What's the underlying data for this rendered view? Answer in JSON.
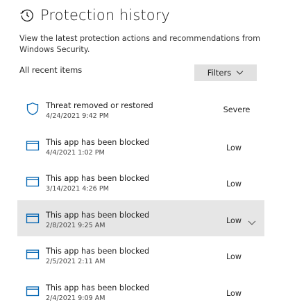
{
  "header": {
    "title": "Protection history",
    "icon": "history-icon"
  },
  "subtitle": "View the latest protection actions and recommendations from Windows Security.",
  "section_label": "All recent items",
  "filters_button": {
    "label": "Filters",
    "icon": "chevron-down-icon"
  },
  "items": [
    {
      "title": "Threat removed or restored",
      "date": "4/24/2021 9:42 PM",
      "severity": "Severe",
      "icon": "shield-icon",
      "selected": false
    },
    {
      "title": "This app has been blocked",
      "date": "4/4/2021 1:02 PM",
      "severity": "Low",
      "icon": "app-window-icon",
      "selected": false
    },
    {
      "title": "This app has been blocked",
      "date": "3/14/2021 4:26 PM",
      "severity": "Low",
      "icon": "app-window-icon",
      "selected": false
    },
    {
      "title": "This app has been blocked",
      "date": "2/8/2021 9:25 AM",
      "severity": "Low",
      "icon": "app-window-icon",
      "selected": true
    },
    {
      "title": "This app has been blocked",
      "date": "2/5/2021 2:11 AM",
      "severity": "Low",
      "icon": "app-window-icon",
      "selected": false
    },
    {
      "title": "This app has been blocked",
      "date": "2/4/2021 9:09 AM",
      "severity": "Low",
      "icon": "app-window-icon",
      "selected": false
    }
  ],
  "colors": {
    "accent": "#0063b1",
    "selected_bg": "#e6e6e6",
    "button_bg": "#e1e1e1"
  }
}
